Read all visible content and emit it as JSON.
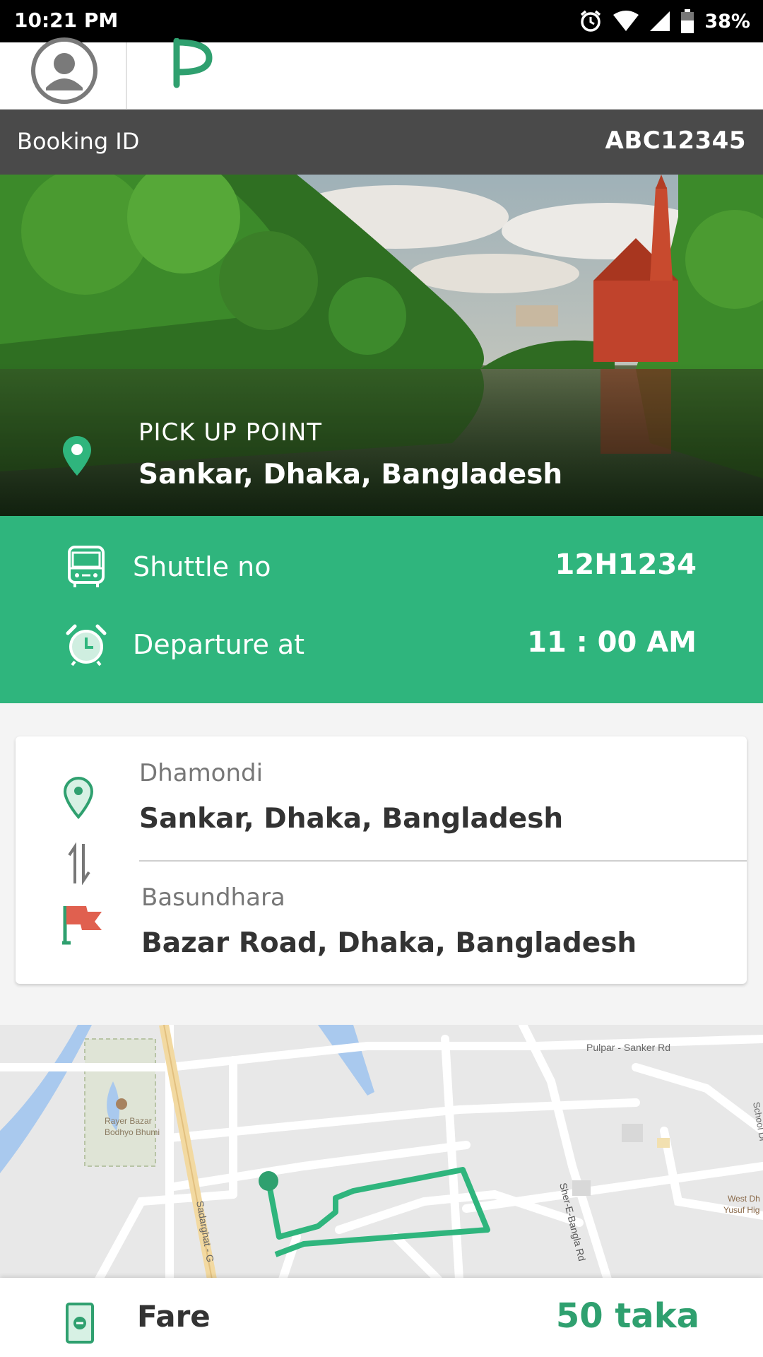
{
  "status_bar": {
    "time": "10:21 PM",
    "battery": "38%"
  },
  "booking": {
    "label": "Booking ID",
    "id": "ABC12345"
  },
  "pickup": {
    "label": "PICK UP POINT",
    "address": "Sankar, Dhaka, Bangladesh"
  },
  "shuttle": {
    "label": "Shuttle no",
    "value": "12H1234"
  },
  "departure": {
    "label": "Departure at",
    "value": "11 : 00 AM"
  },
  "route": {
    "from_name": "Dhamondi",
    "from_address": "Sankar, Dhaka, Bangladesh",
    "to_name": "Basundhara",
    "to_address": "Bazar Road, Dhaka, Bangladesh"
  },
  "map": {
    "labels": {
      "pulpar": "Pulpar - Sanker Rd",
      "sher": "Sher-E-Bangla Rd",
      "rayer1": "Rayer Bazar",
      "rayer2": "Bodhyo Bhumi",
      "sadarghat": "Sadarghat - G",
      "school": "School Di",
      "west1": "West Dh",
      "west2": "Yusuf Hig"
    }
  },
  "fare": {
    "label": "Fare",
    "value": "50 taka"
  },
  "colors": {
    "primary_green": "#2fb57d",
    "dark_bar": "#4a4a4a",
    "flag_red": "#e0604f"
  },
  "icons": [
    "alarm-icon",
    "wifi-icon",
    "signal-icon",
    "battery-icon",
    "profile-icon",
    "app-logo-icon",
    "location-pin-icon",
    "bus-icon",
    "alarm-clock-icon",
    "swap-icon",
    "flag-icon",
    "ticket-icon"
  ]
}
